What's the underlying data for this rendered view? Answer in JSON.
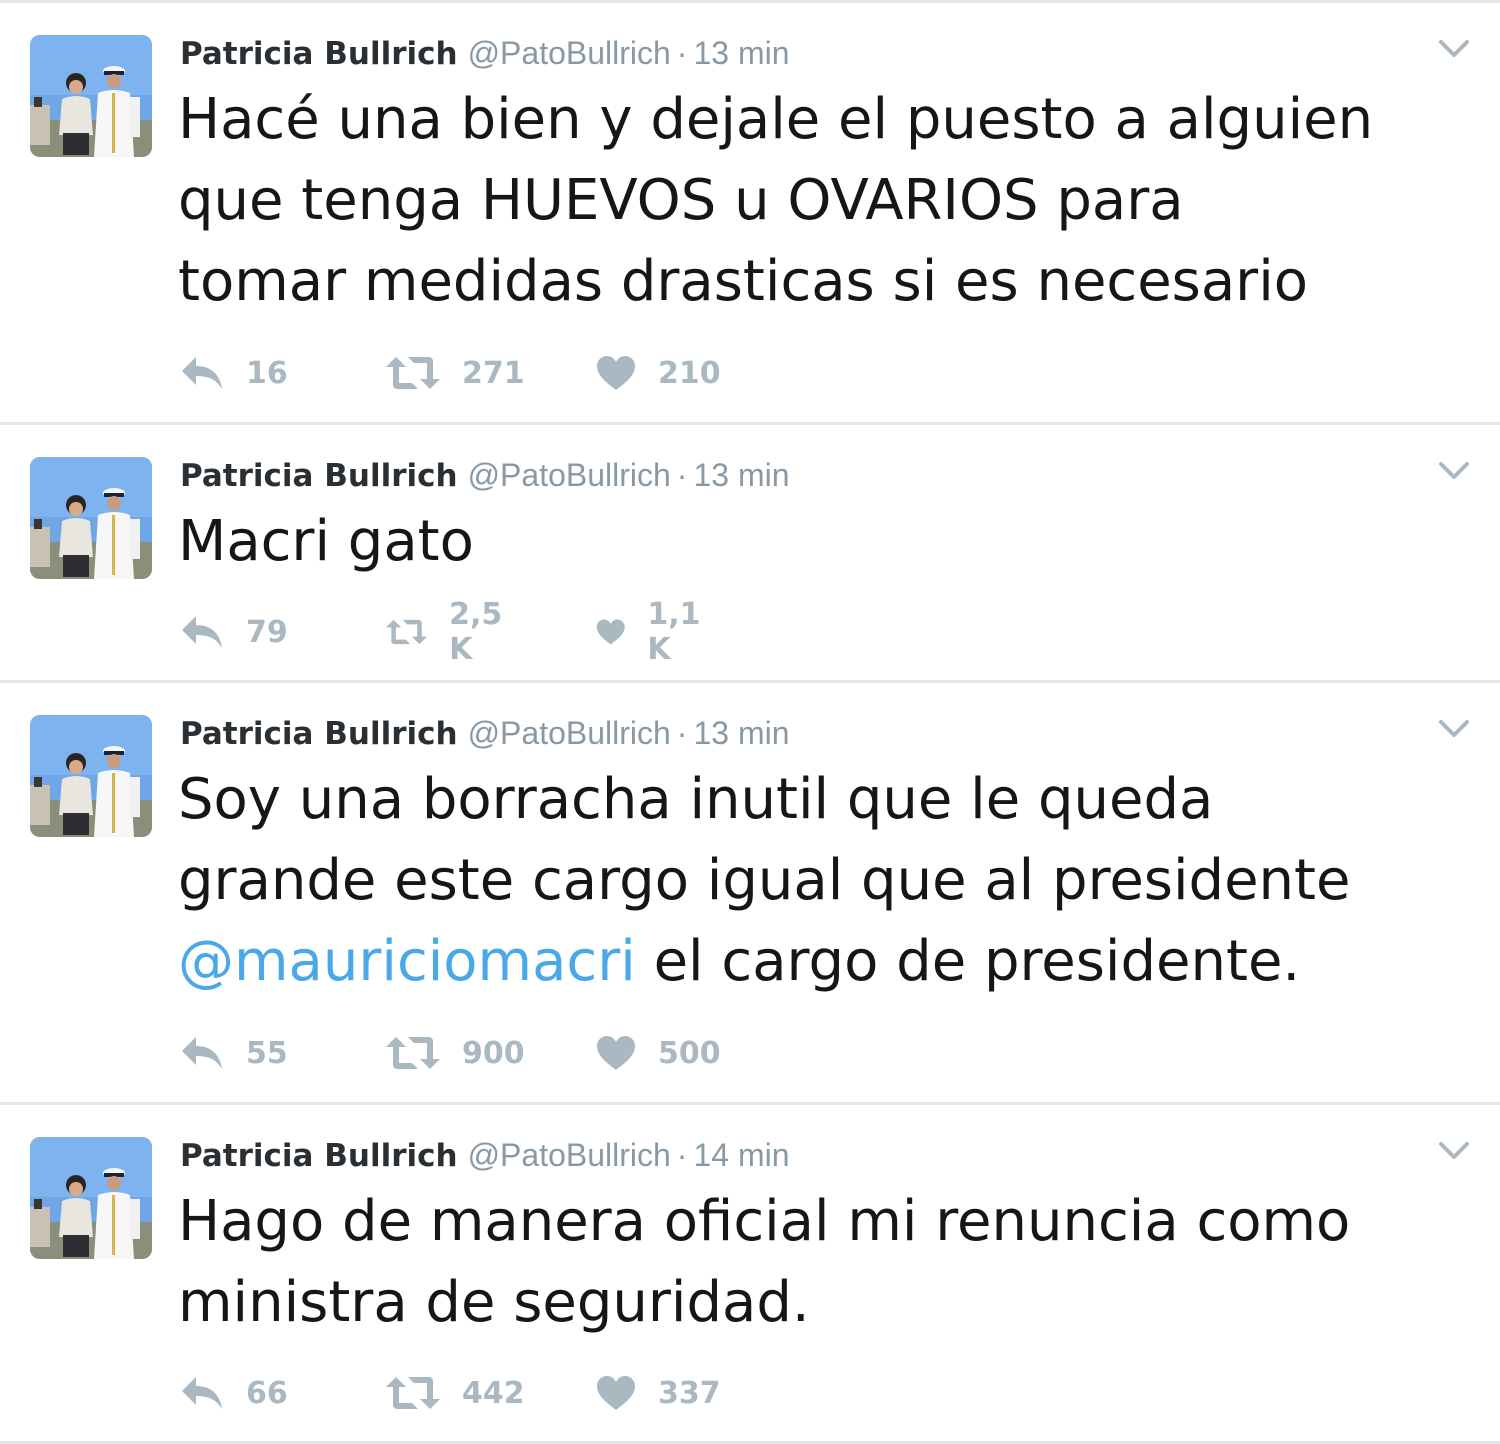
{
  "tweets": [
    {
      "name": "Patricia Bullrich",
      "handle": "@PatoBullrich",
      "separator": "·",
      "time": "13 min",
      "text_lines": [
        "Hacé una bien y dejale el puesto a alguien",
        "que tenga HUEVOS u OVARIOS para",
        "tomar medidas drasticas si es necesario"
      ],
      "replies": "16",
      "retweets": "271",
      "likes": "210"
    },
    {
      "name": "Patricia Bullrich",
      "handle": "@PatoBullrich",
      "separator": "·",
      "time": "13 min",
      "text_lines": [
        "Macri gato"
      ],
      "replies": "79",
      "retweets": "2,5 K",
      "likes": "1,1 K"
    },
    {
      "name": "Patricia Bullrich",
      "handle": "@PatoBullrich",
      "separator": "·",
      "time": "13 min",
      "text_lines": [
        "Soy una borracha inutil que le queda",
        "grande este cargo igual que al presidente"
      ],
      "mention": "@mauriciomacri",
      "text_after_mention": " el cargo de presidente.",
      "replies": "55",
      "retweets": "900",
      "likes": "500"
    },
    {
      "name": "Patricia Bullrich",
      "handle": "@PatoBullrich",
      "separator": "·",
      "time": "14 min",
      "text_lines": [
        "Hago de manera oficial mi renuncia como",
        "ministra de seguridad."
      ],
      "replies": "66",
      "retweets": "442",
      "likes": "337"
    }
  ],
  "icons": {
    "reply": "reply-icon",
    "retweet": "retweet-icon",
    "like": "heart-icon",
    "caret": "chevron-down-icon"
  },
  "colors": {
    "name": "#292f33",
    "meta": "#8899a6",
    "text": "#14171a",
    "mention": "#4aa8e8",
    "action": "#aab8c2",
    "divider": "#e1e8ed"
  }
}
